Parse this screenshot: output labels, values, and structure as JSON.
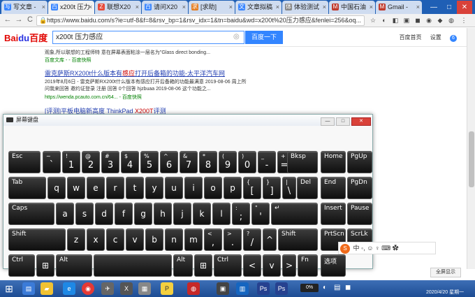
{
  "tabs": [
    {
      "label": "写文章 -",
      "color": "#3a86ff",
      "glyph": "写"
    },
    {
      "label": "x200t 压力",
      "color": "#3a86ff",
      "glyph": "百",
      "active": true
    },
    {
      "label": "联想X20",
      "color": "#e74c3c",
      "glyph": "Z"
    },
    {
      "label": "请问X20",
      "color": "#3a86ff",
      "glyph": "百"
    },
    {
      "label": "[求助]",
      "color": "#e67e22",
      "glyph": "求"
    },
    {
      "label": "文章拟稿",
      "color": "#3a86ff",
      "glyph": "文"
    },
    {
      "label": "体验测试",
      "color": "#888888",
      "glyph": "体"
    },
    {
      "label": "中国石油",
      "color": "#c0392b",
      "glyph": "M"
    },
    {
      "label": "Gmail -",
      "color": "#c0392b",
      "glyph": "M"
    }
  ],
  "address": {
    "url": "https://www.baidu.com/s?ie=utf-8&f=8&rsv_bp=1&rsv_idx=1&tn=baidu&wd=x200t%20压力感应&fenlei=256&oq...",
    "back": "←",
    "forward": "→",
    "reload": "C"
  },
  "baidu": {
    "logo_a": "Bai",
    "logo_b": "du",
    "logo_c": "百度",
    "query": "x200t 压力感应",
    "search_button": "百度一下",
    "links": [
      "百度首页",
      "设置"
    ],
    "more": "6"
  },
  "results": {
    "snippet_top": "观象,所以联想的工程师特 意在屏幕表面粘涂一层名为\"Glass direct bonding...",
    "source_top": "百度文库 - - 百度快照",
    "title1_pre": "雷克萨斯RX200t什么版本有",
    "title1_em": "感应",
    "title1_post": "打开后备箱的功能-太平洋汽车网",
    "snippet1_line1": "2019年8月6日 - 雷克萨斯RX200t什么版本有感应打开后备箱的功能最满意 2019-08-06 周上所",
    "snippet1_line2": "问我来回答 邀约证登录 注册 回答 0个回答 hjzbuaa 2019-08-06 这个功能之...",
    "source1": "https://wenda.pcauto.com.cn/64... - 百度快照",
    "title2_pre": "[评测]平板电脑新高度 ThinkPad ",
    "title2_em": "X200T",
    "title2_post": "评测"
  },
  "osk": {
    "title": "屏幕键盘",
    "min": "—",
    "restore": "□",
    "close": "✕"
  },
  "keys": {
    "esc": "Esc",
    "tilde_top": "~",
    "tilde": "`",
    "n1_top": "!",
    "n1": "1",
    "n2_top": "@",
    "n2": "2",
    "n3_top": "#",
    "n3": "3",
    "n4_top": "$",
    "n4": "4",
    "n5_top": "%",
    "n5": "5",
    "n6_top": "^",
    "n6": "6",
    "n7_top": "&",
    "n7": "7",
    "n8_top": "*",
    "n8": "8",
    "n9_top": "(",
    "n9": "9",
    "n0_top": ")",
    "n0": "0",
    "minus_top": "_",
    "minus": "-",
    "eq_top": "+",
    "eq": "=",
    "bksp": "Bksp",
    "home": "Home",
    "pgup": "PgUp",
    "tab": "Tab",
    "q": "q",
    "w": "w",
    "e": "e",
    "r": "r",
    "t": "t",
    "y": "y",
    "u": "u",
    "i": "i",
    "o": "o",
    "p": "p",
    "lbr_top": "{",
    "lbr": "[",
    "rbr_top": "}",
    "rbr": "]",
    "bsl_top": "|",
    "bsl": "\\",
    "del": "Del",
    "end": "End",
    "pgdn": "PgDn",
    "caps": "Caps",
    "a": "a",
    "s": "s",
    "d": "d",
    "f": "f",
    "g": "g",
    "h": "h",
    "j": "j",
    "k": "k",
    "l": "l",
    "semi_top": ":",
    "semi": ";",
    "quote_top": "\"",
    "quote": "'",
    "enter": "↵",
    "insert": "Insert",
    "pause": "Pause",
    "shift": "Shift",
    "z": "z",
    "x": "x",
    "c": "c",
    "v": "v",
    "b": "b",
    "n": "n",
    "m": "m",
    "comma_top": "<",
    "comma": ",",
    "period_top": ">",
    "period": ".",
    "slash_top": "?",
    "slash": "/",
    "up": "^",
    "shift_r": "Shift",
    "prtscn": "PrtScn",
    "scrlk": "ScrLk",
    "ctrl": "Ctrl",
    "win": "⊞",
    "alt": "Alt",
    "alt_r": "Alt",
    "win_r": "⊞",
    "ctrl_r": "Ctrl",
    "left": "<",
    "down": "v",
    "right": ">",
    "fn": "Fn",
    "options": "选项"
  },
  "ime": {
    "logo": "S",
    "text": "中 ◦, ☺ ♀ ⌨ ✿"
  },
  "fullscreen": "全屏显示",
  "taskbar": {
    "battery": "0%",
    "clock": "2020/4/20 星期一"
  }
}
